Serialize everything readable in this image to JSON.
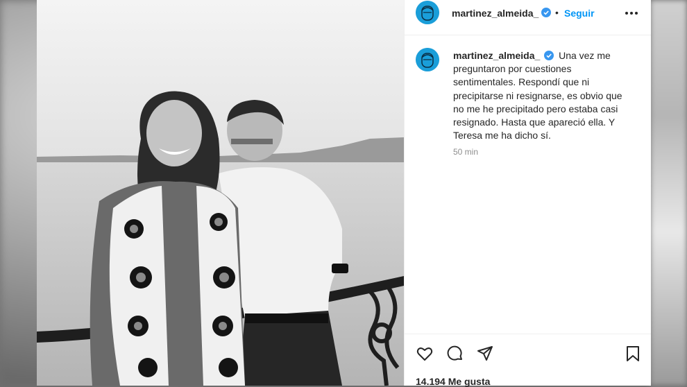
{
  "post": {
    "username": "martinez_almeida_",
    "separator": "•",
    "follow_label": "Seguir",
    "caption": "Una vez me preguntaron por cuestiones sentimentales. Respondí que ni precipitarse ni resignarse, es obvio que no me he precipitado pero estaba casi resignado. Hasta que apareció ella. Y Teresa me ha dicho sí.",
    "time_ago": "50 min",
    "likes": "14.194 Me gusta"
  },
  "colors": {
    "accent": "#0095f6",
    "avatar_bg": "#1a9ed9",
    "verified": "#3897f0"
  },
  "icons": [
    "more-options-icon",
    "verified-icon",
    "heart-icon",
    "comment-icon",
    "share-icon",
    "bookmark-icon"
  ]
}
